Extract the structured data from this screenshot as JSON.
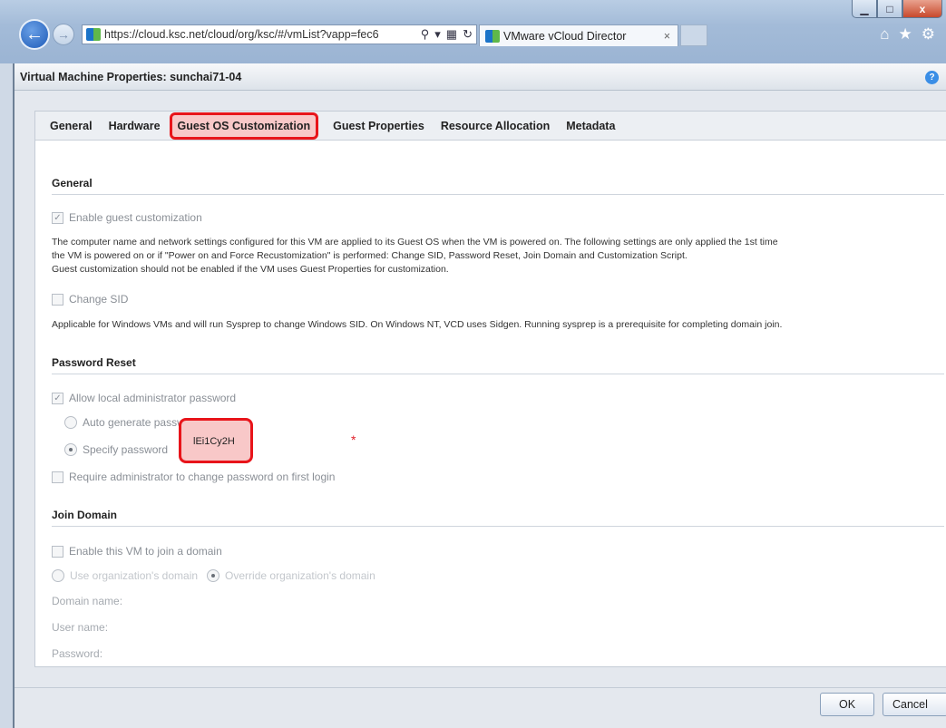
{
  "browser": {
    "url": "https://cloud.ksc.net/cloud/org/ksc/#/vmList?vapp=fec6",
    "tab_title": "VMware vCloud Director",
    "tab_close": "×",
    "back": "←",
    "forward": "→",
    "minimize": "▁",
    "maximize": "□",
    "close": "x",
    "addr_tools": [
      "⚲",
      "▾",
      "▦",
      "↻"
    ],
    "nav_icons": [
      "⌂",
      "★",
      "⚙"
    ]
  },
  "dialog": {
    "title": "Virtual Machine Properties: sunchai71-04",
    "help": "?",
    "tabs": [
      "General",
      "Hardware",
      "Guest OS Customization",
      "Guest Properties",
      "Resource Allocation",
      "Metadata"
    ],
    "active_tab": "Guest OS Customization",
    "general": {
      "heading": "General",
      "enable_customization": "Enable guest customization",
      "description_1": "The computer name and network settings configured for this VM are applied to its Guest OS when the VM is powered on. The following settings are only applied the 1st time",
      "description_2": "the VM is powered on or if \"Power on and Force Recustomization\" is performed: Change SID, Password Reset, Join Domain and Customization Script.",
      "description_3": "Guest customization should not be enabled if the VM uses Guest Properties for customization.",
      "change_sid": "Change SID",
      "sid_note": "Applicable for Windows VMs and will run Sysprep to change Windows SID. On Windows NT, VCD uses Sidgen. Running sysprep is a prerequisite for completing domain join."
    },
    "password_reset": {
      "heading": "Password Reset",
      "allow_local_admin": "Allow local administrator password",
      "auto_generate": "Auto generate password",
      "specify_password": "Specify password",
      "password_value": "lEi1Cy2H",
      "required_marker": "*",
      "require_change": "Require administrator to change password on first login"
    },
    "join_domain": {
      "heading": "Join Domain",
      "enable_join": "Enable this VM to join a domain",
      "use_org_domain": "Use organization's domain",
      "override_org_domain": "Override organization's domain",
      "domain_name": "Domain name:",
      "user_name": "User name:",
      "password": "Password:"
    },
    "buttons": {
      "ok": "OK",
      "cancel": "Cancel"
    }
  }
}
